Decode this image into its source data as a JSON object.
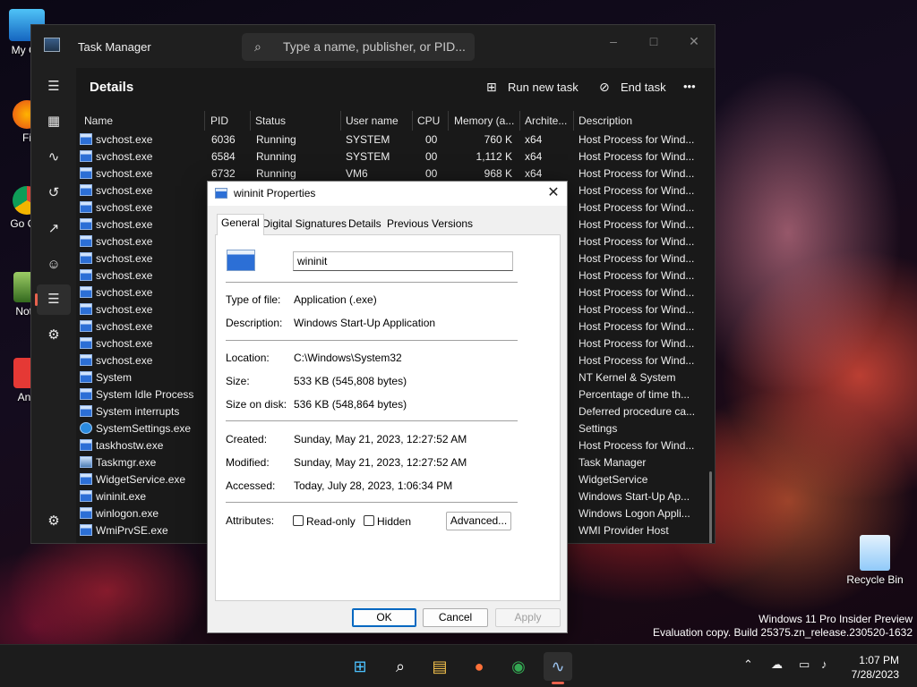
{
  "desktop": {
    "icons_left": [
      "My Co",
      "Fi",
      "Go Chi",
      "Note",
      "Any"
    ],
    "recycle_bin_label": "Recycle Bin",
    "watermark_line1": "Windows 11 Pro Insider Preview",
    "watermark_line2": "Evaluation copy. Build 25375.zn_release.230520-1632"
  },
  "taskmgr": {
    "title": "Task Manager",
    "search_placeholder": "Type a name, publisher, or PID...",
    "page_title": "Details",
    "run_new_task": "Run new task",
    "end_task": "End task",
    "more": "•••",
    "columns": [
      "Name",
      "PID",
      "Status",
      "User name",
      "CPU",
      "Memory (a...",
      "Archite...",
      "Description"
    ],
    "rows": [
      {
        "name": "svchost.exe",
        "pid": "6036",
        "status": "Running",
        "user": "SYSTEM",
        "cpu": "00",
        "mem": "760 K",
        "arch": "x64",
        "desc": "Host Process for Wind..."
      },
      {
        "name": "svchost.exe",
        "pid": "6584",
        "status": "Running",
        "user": "SYSTEM",
        "cpu": "00",
        "mem": "1,112 K",
        "arch": "x64",
        "desc": "Host Process for Wind..."
      },
      {
        "name": "svchost.exe",
        "pid": "6732",
        "status": "Running",
        "user": "VM6",
        "cpu": "00",
        "mem": "968 K",
        "arch": "x64",
        "desc": "Host Process for Wind..."
      },
      {
        "name": "svchost.exe",
        "desc": "Host Process for Wind..."
      },
      {
        "name": "svchost.exe",
        "desc": "Host Process for Wind..."
      },
      {
        "name": "svchost.exe",
        "desc": "Host Process for Wind..."
      },
      {
        "name": "svchost.exe",
        "desc": "Host Process for Wind..."
      },
      {
        "name": "svchost.exe",
        "desc": "Host Process for Wind..."
      },
      {
        "name": "svchost.exe",
        "desc": "Host Process for Wind..."
      },
      {
        "name": "svchost.exe",
        "desc": "Host Process for Wind..."
      },
      {
        "name": "svchost.exe",
        "desc": "Host Process for Wind..."
      },
      {
        "name": "svchost.exe",
        "desc": "Host Process for Wind..."
      },
      {
        "name": "svchost.exe",
        "desc": "Host Process for Wind..."
      },
      {
        "name": "svchost.exe",
        "desc": "Host Process for Wind..."
      },
      {
        "name": "System",
        "desc": "NT Kernel & System"
      },
      {
        "name": "System Idle Process",
        "desc": "Percentage of time th..."
      },
      {
        "name": "System interrupts",
        "desc": "Deferred procedure ca..."
      },
      {
        "name": "SystemSettings.exe",
        "desc": "Settings",
        "icon": "gear"
      },
      {
        "name": "taskhostw.exe",
        "desc": "Host Process for Wind..."
      },
      {
        "name": "Taskmgr.exe",
        "desc": "Task Manager",
        "icon": "tm"
      },
      {
        "name": "WidgetService.exe",
        "desc": "WidgetService"
      },
      {
        "name": "wininit.exe",
        "desc": "Windows Start-Up Ap..."
      },
      {
        "name": "winlogon.exe",
        "desc": "Windows Logon Appli..."
      },
      {
        "name": "WmiPrvSE.exe",
        "desc": "WMI Provider Host"
      }
    ]
  },
  "props": {
    "title": "wininit Properties",
    "tabs": [
      "General",
      "Digital Signatures",
      "Details",
      "Previous Versions"
    ],
    "name_value": "wininit",
    "type_label": "Type of file:",
    "type_value": "Application (.exe)",
    "desc_label": "Description:",
    "desc_value": "Windows Start-Up Application",
    "location_label": "Location:",
    "location_value": "C:\\Windows\\System32",
    "size_label": "Size:",
    "size_value": "533 KB (545,808 bytes)",
    "size_disk_label": "Size on disk:",
    "size_disk_value": "536 KB (548,864 bytes)",
    "created_label": "Created:",
    "created_value": "Sunday, May 21, 2023, 12:27:52 AM",
    "modified_label": "Modified:",
    "modified_value": "Sunday, May 21, 2023, 12:27:52 AM",
    "accessed_label": "Accessed:",
    "accessed_value": "Today, July 28, 2023, 1:06:34 PM",
    "attributes_label": "Attributes:",
    "readonly_label": "Read-only",
    "hidden_label": "Hidden",
    "advanced_label": "Advanced...",
    "ok_label": "OK",
    "cancel_label": "Cancel",
    "apply_label": "Apply"
  },
  "taskbar": {
    "time": "1:07 PM",
    "date": "7/28/2023"
  }
}
